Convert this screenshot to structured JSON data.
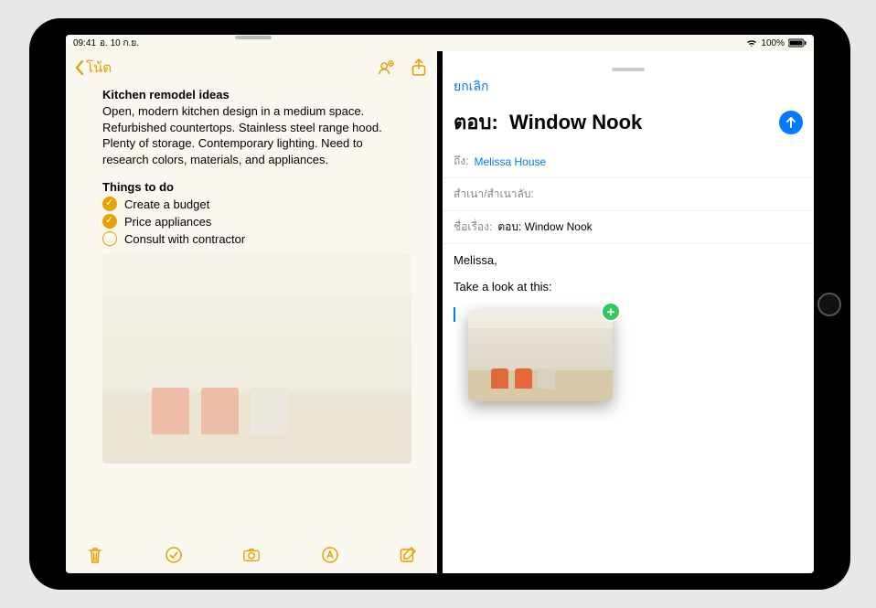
{
  "status": {
    "time": "09:41",
    "date": "อ. 10 ก.ย.",
    "battery": "100%"
  },
  "notes": {
    "back": "โน้ต",
    "title": "Kitchen remodel ideas",
    "body": "Open, modern kitchen design in a medium space. Refurbished countertops. Stainless steel range hood. Plenty of storage. Contemporary lighting. Need to research colors, materials, and appliances.",
    "todo_title": "Things to do",
    "todos": [
      {
        "label": "Create a budget",
        "done": true
      },
      {
        "label": "Price appliances",
        "done": true
      },
      {
        "label": "Consult with contractor",
        "done": false
      }
    ]
  },
  "mail": {
    "cancel": "ยกเลิก",
    "reply_prefix": "ตอบ:",
    "subject_title": "Window Nook",
    "to_label": "ถึง:",
    "to_value": "Melissa House",
    "cc_label": "สำเนา/สำเนาลับ:",
    "subject_label": "ชื่อเรื่อง:",
    "subject_value": "ตอบ:  Window Nook",
    "body_line1": "Melissa,",
    "body_line2": "Take a look at this:"
  }
}
